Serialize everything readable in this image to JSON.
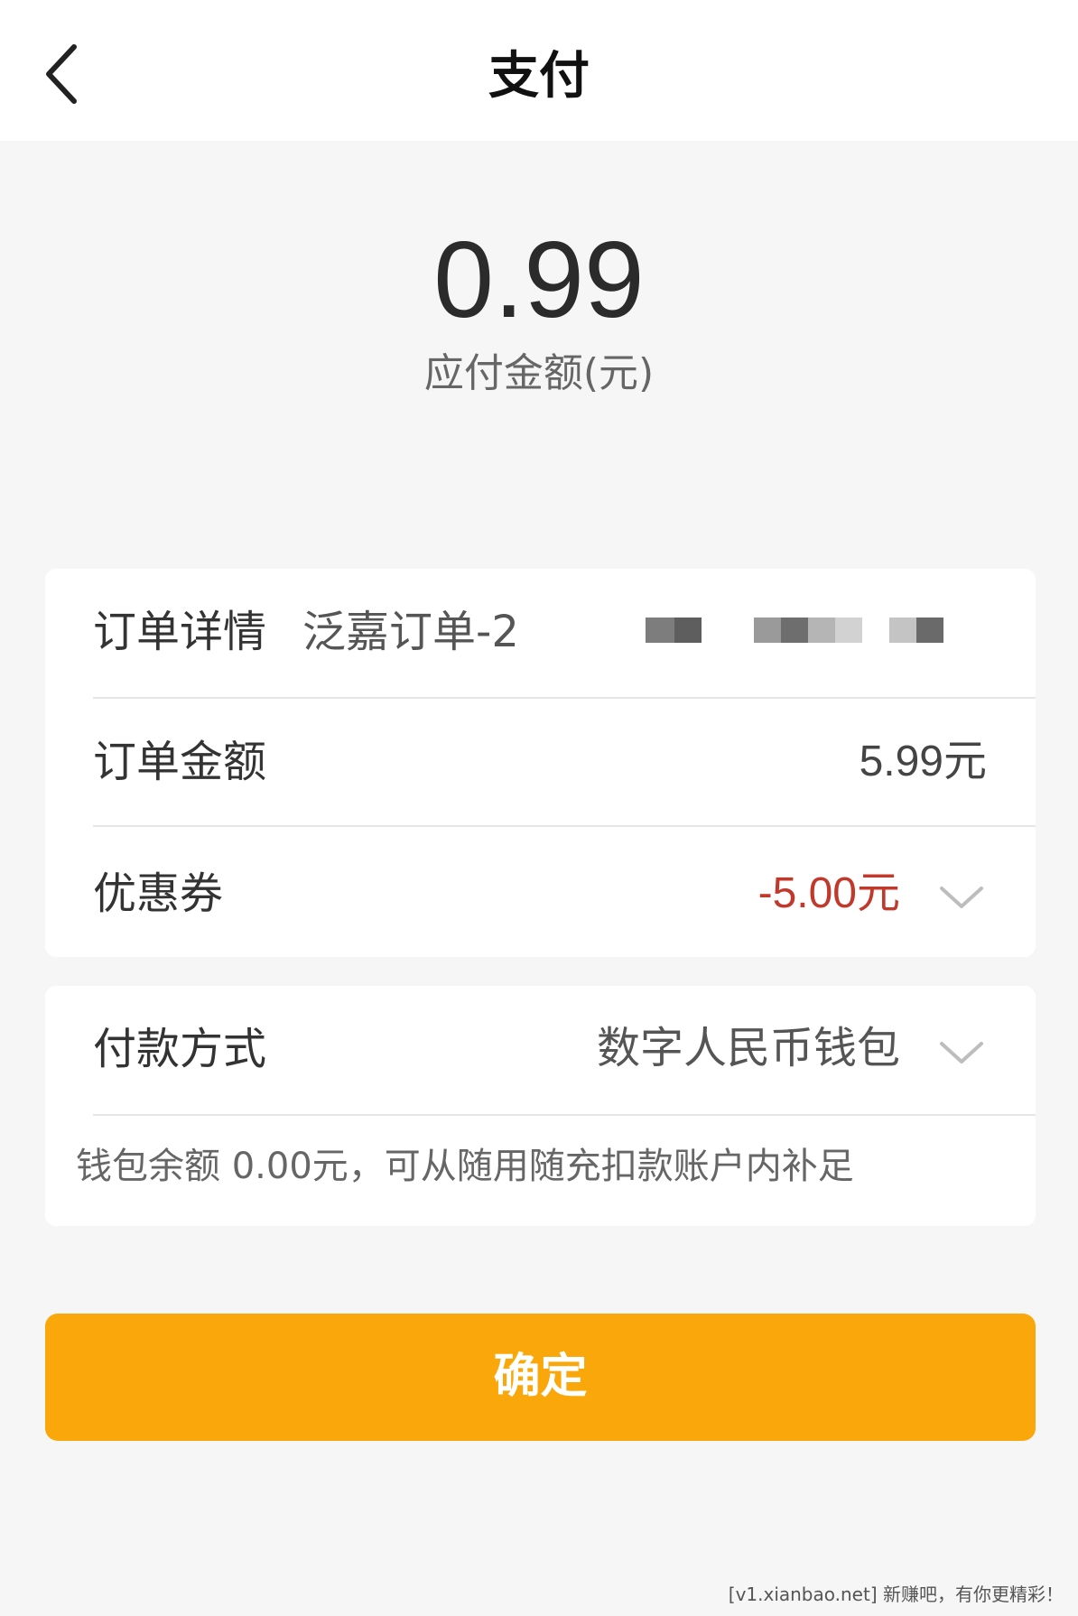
{
  "header": {
    "title": "支付",
    "back_icon": "chevron-left-icon"
  },
  "payment": {
    "amount": "0.99",
    "amount_label": "应付金额(元)"
  },
  "order": {
    "detail_label": "订单详情",
    "detail_value": "泛嘉订单-2",
    "amount_label": "订单金额",
    "amount_value": "5.99元",
    "coupon_label": "优惠券",
    "coupon_value": "-5.00元",
    "coupon_color": "#c0392b"
  },
  "payment_method": {
    "label": "付款方式",
    "value": "数字人民币钱包",
    "balance_note": "钱包余额  0.00元，可从随用随充扣款账户内补足"
  },
  "confirm": {
    "label": "确定",
    "color": "#f9a70b"
  },
  "watermark": "[v1.xianbao.net] 新赚吧，有你更精彩！"
}
